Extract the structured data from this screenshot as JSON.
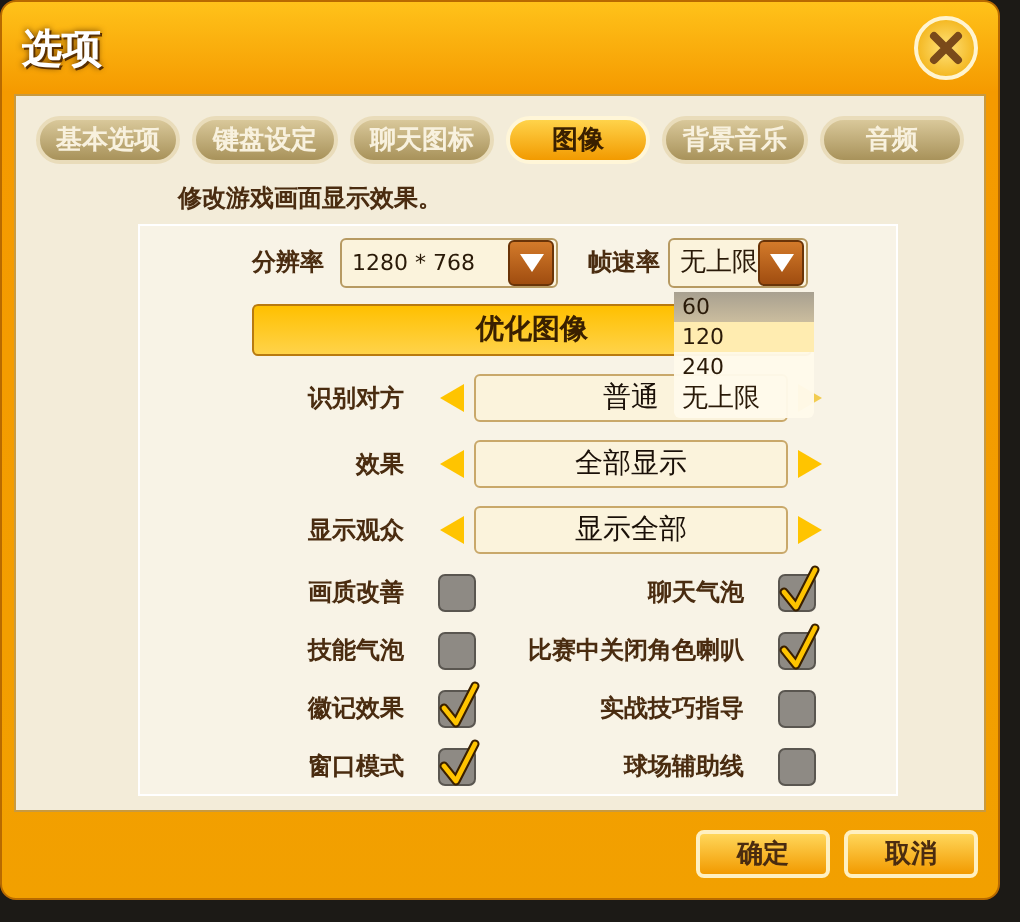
{
  "window": {
    "title": "选项"
  },
  "tabs": [
    {
      "label": "基本选项",
      "selected": false
    },
    {
      "label": "键盘设定",
      "selected": false
    },
    {
      "label": "聊天图标",
      "selected": false
    },
    {
      "label": "图像",
      "selected": true
    },
    {
      "label": "背景音乐",
      "selected": false
    },
    {
      "label": "音频",
      "selected": false
    }
  ],
  "description": "修改游戏画面显示效果。",
  "resolution": {
    "label": "分辨率",
    "value": "1280 * 768"
  },
  "frame_rate": {
    "label": "帧速率",
    "value": "无上限",
    "expanded": true,
    "options": [
      {
        "label": "60",
        "highlighted": true,
        "hovered": false
      },
      {
        "label": "120",
        "highlighted": false,
        "hovered": true
      },
      {
        "label": "240",
        "highlighted": false,
        "hovered": false
      },
      {
        "label": "无上限",
        "highlighted": false,
        "hovered": false
      }
    ]
  },
  "optimize_button": "优化图像",
  "selectors": [
    {
      "label": "识别对方",
      "value": "普通"
    },
    {
      "label": "效果",
      "value": "全部显示"
    },
    {
      "label": "显示观众",
      "value": "显示全部"
    }
  ],
  "checkboxes": [
    {
      "label": "画质改善",
      "checked": false
    },
    {
      "label": "聊天气泡",
      "checked": true
    },
    {
      "label": "技能气泡",
      "checked": false
    },
    {
      "label": "比赛中关闭角色喇叭",
      "checked": true
    },
    {
      "label": "徽记效果",
      "checked": true
    },
    {
      "label": "实战技巧指导",
      "checked": false
    },
    {
      "label": "窗口模式",
      "checked": true
    },
    {
      "label": "球场辅助线",
      "checked": false
    }
  ],
  "buttons": [
    "确定",
    "取消"
  ]
}
